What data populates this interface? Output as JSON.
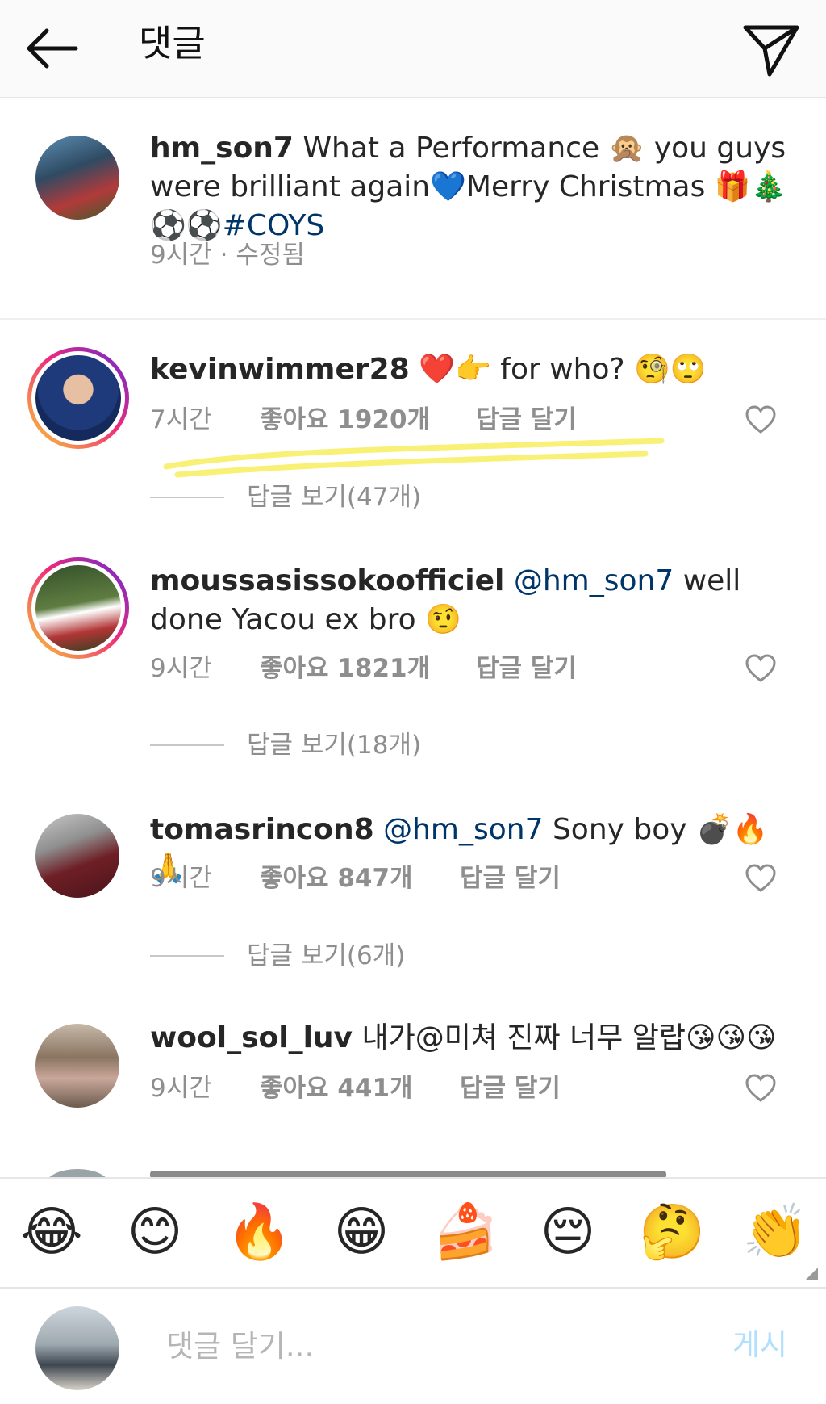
{
  "header": {
    "title": "댓글"
  },
  "caption": {
    "username": "hm_son7",
    "text_part1": "What a Performance 🙊 you guys were brilliant again💙Merry Christmas 🎁🎄⚽⚽",
    "hashtag": "#COYS",
    "meta": "9시간 · 수정됨"
  },
  "comments": [
    {
      "username": "kevinwimmer28",
      "text": "❤️👉 for who? 🧐🙄",
      "time": "7시간",
      "likes": "좋아요 1920개",
      "reply": "답글 달기",
      "view_replies": "답글 보기(47개)"
    },
    {
      "username": "moussasissokoofficiel",
      "mention": "@hm_son7",
      "text": "well done Yacou ex bro 🤨",
      "time": "9시간",
      "likes": "좋아요 1821개",
      "reply": "답글 달기",
      "view_replies": "답글 보기(18개)"
    },
    {
      "username": "tomasrincon8",
      "mention": "@hm_son7",
      "text": "Sony boy 💣🔥🙏",
      "time": "9시간",
      "likes": "좋아요 847개",
      "reply": "답글 달기",
      "view_replies": "답글 보기(6개)"
    },
    {
      "username": "wool_sol_luv",
      "text": "내가@미쳐 진짜 너무 알랍😘😘😘",
      "time": "9시간",
      "likes": "좋아요 441개",
      "reply": "답글 달기"
    }
  ],
  "emoji_bar": [
    "😂",
    "😊",
    "🔥",
    "😁",
    "🍰",
    "😔",
    "🤔",
    "👏"
  ],
  "composer": {
    "placeholder": "댓글 달기...",
    "post_label": "게시"
  }
}
